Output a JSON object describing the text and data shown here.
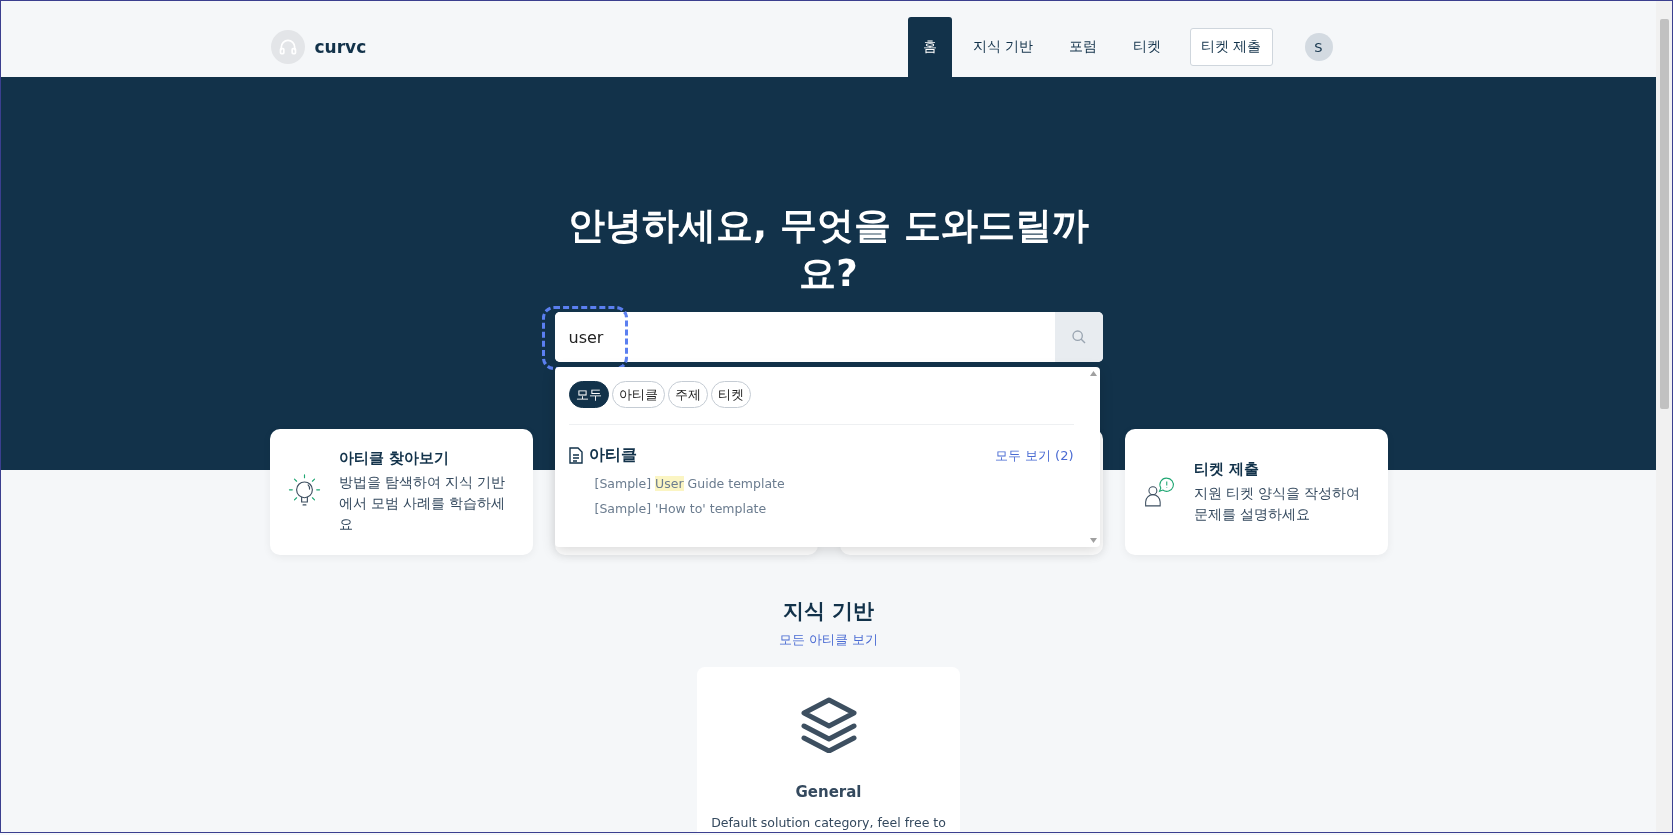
{
  "header": {
    "logo_text": "curvc",
    "nav": [
      {
        "label": "홈",
        "selected": true
      },
      {
        "label": "지식 기반",
        "selected": false
      },
      {
        "label": "포럼",
        "selected": false
      },
      {
        "label": "티켓",
        "selected": false
      }
    ],
    "submit_button": "티켓 제출",
    "avatar": "S"
  },
  "hero": {
    "title": "안녕하세요, 무엇을 도와드릴까요?",
    "search": {
      "value": "user"
    }
  },
  "dropdown": {
    "filters": [
      {
        "label": "모두",
        "selected": true
      },
      {
        "label": "아티클",
        "selected": false
      },
      {
        "label": "주제",
        "selected": false
      },
      {
        "label": "티켓",
        "selected": false
      }
    ],
    "section": {
      "title": "아티클",
      "view_all": "모두 보기",
      "count": "(2)",
      "results": [
        {
          "before": "[Sample] ",
          "match": "User",
          "after": " Guide template"
        },
        {
          "before": "[Sample] 'How to' template"
        }
      ]
    }
  },
  "cards": [
    {
      "kind": "bulb",
      "title": "아티클 찾아보기",
      "text": "방법을 탐색하여 지식 기반에서 모범 사례를 학습하세요"
    },
    {
      "kind": "blank"
    },
    {
      "kind": "blank"
    },
    {
      "kind": "ticket",
      "title": "티켓 제출",
      "text": "지원 티켓 양식을 작성하여 문제를 설명하세요"
    }
  ],
  "knowledge": {
    "title": "지식 기반",
    "link": "모든 아티클 보기",
    "categories": [
      {
        "name": "General",
        "description": "Default solution category, feel free to"
      }
    ]
  }
}
